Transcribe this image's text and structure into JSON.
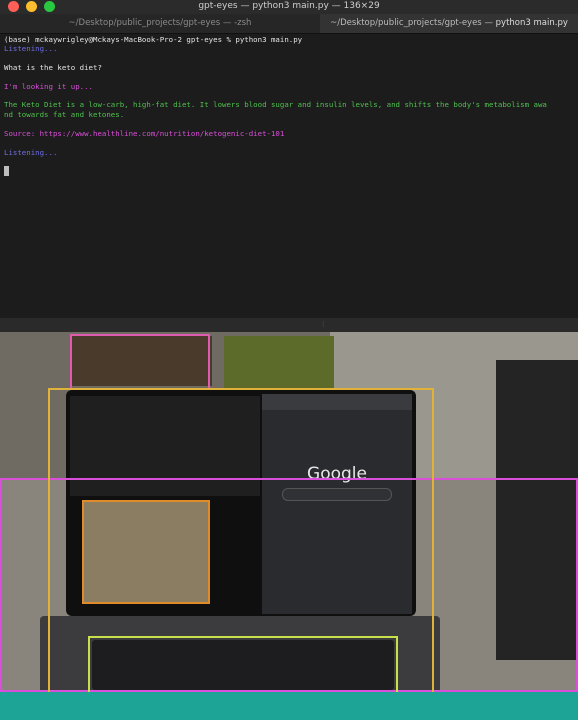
{
  "window": {
    "title": "gpt-eyes — python3 main.py — 136×29"
  },
  "tabs": [
    {
      "label": "~/Desktop/public_projects/gpt-eyes — -zsh",
      "active": false
    },
    {
      "label_path": "~/Desktop/public_projects/gpt-eyes — ",
      "label_cmd": "python3 main.py",
      "active": true
    }
  ],
  "terminal": {
    "lines": [
      {
        "text": "(base) mckaywrigley@Mckays-MacBook-Pro-2 gpt-eyes % python3 main.py",
        "color": "white"
      },
      {
        "text": "Listening...",
        "color": "blue"
      },
      {
        "text": "What is the keto diet?",
        "color": "white"
      },
      {
        "text": "I'm looking it up...",
        "color": "magenta"
      },
      {
        "text": "The Keto Diet is a low-carb, high-fat diet. It lowers blood sugar and insulin levels, and shifts the body's metabolism awa",
        "color": "green"
      },
      {
        "text": "nd towards fat and ketones.",
        "color": "green"
      },
      {
        "text": "Source: https://www.healthline.com/nutrition/ketogenic-diet-101",
        "color": "magenta"
      },
      {
        "text": "Listening...",
        "color": "blue"
      }
    ]
  },
  "divider_glyph": "⁝",
  "camera": {
    "google_logo_text": "Google",
    "box_colors": {
      "laptop": "#e0b23a",
      "keyboard": "#c8e04a",
      "inner_screen": "#e08a2a",
      "magenta": "#d94fd9",
      "pink": "#e05ab0"
    }
  },
  "colors": {
    "background": "#1c1c1c",
    "teal_band": "#1ea497"
  }
}
